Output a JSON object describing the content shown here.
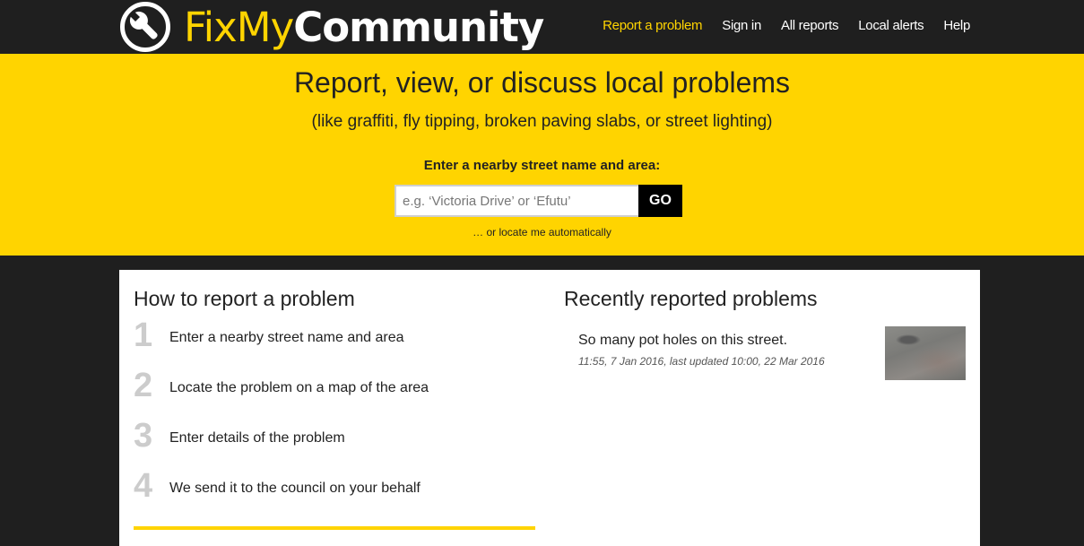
{
  "brand": {
    "name_part1": "FixMy",
    "name_part2": "Community",
    "accent_color": "#ffd400"
  },
  "nav": [
    {
      "label": "Report a problem",
      "active": true
    },
    {
      "label": "Sign in"
    },
    {
      "label": "All reports"
    },
    {
      "label": "Local alerts"
    },
    {
      "label": "Help"
    }
  ],
  "hero": {
    "title": "Report, view, or discuss local problems",
    "subtitle": "(like graffiti, fly tipping, broken paving slabs, or street lighting)",
    "search_label": "Enter a nearby street name and area:",
    "search_placeholder": "e.g. ‘Victoria Drive’ or ‘Efutu’",
    "search_value": "",
    "go_label": "GO",
    "locate_link": "… or locate me automatically"
  },
  "how_to": {
    "heading": "How to report a problem",
    "steps": [
      {
        "num": "1",
        "text": "Enter a nearby street name and area"
      },
      {
        "num": "2",
        "text": "Locate the problem on a map of the area"
      },
      {
        "num": "3",
        "text": "Enter details of the problem"
      },
      {
        "num": "4",
        "text": "We send it to the council on your behalf"
      }
    ]
  },
  "recent": {
    "heading": "Recently reported problems",
    "items": [
      {
        "title": "So many pot holes on this street.",
        "meta": "11:55, 7 Jan 2016, last updated 10:00, 22 Mar 2016",
        "thumbnail": "pothole-photo"
      }
    ]
  }
}
